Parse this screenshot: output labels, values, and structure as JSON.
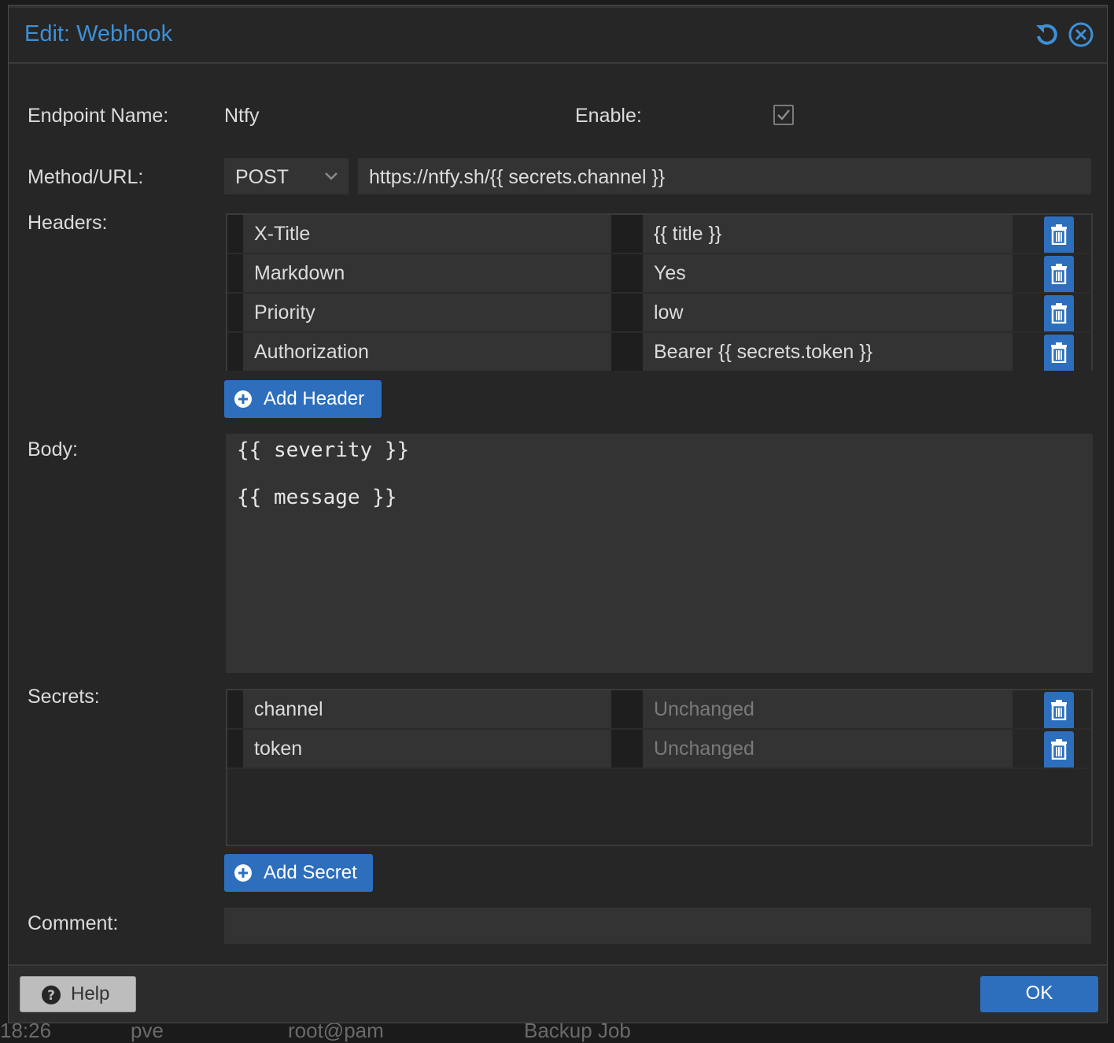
{
  "dialog": {
    "title": "Edit: Webhook",
    "reset_icon": "undo-icon",
    "close_icon": "close-circle-icon"
  },
  "form": {
    "endpoint_name_label": "Endpoint Name:",
    "endpoint_name_value": "Ntfy",
    "enable_label": "Enable:",
    "enable_checked": true,
    "method_url_label": "Method/URL:",
    "method_value": "POST",
    "url_value": "https://ntfy.sh/{{ secrets.channel }}",
    "headers_label": "Headers:",
    "headers": [
      {
        "key": "X-Title",
        "value": "{{ title }}"
      },
      {
        "key": "Markdown",
        "value": "Yes"
      },
      {
        "key": "Priority",
        "value": "low"
      },
      {
        "key": "Authorization",
        "value": "Bearer {{ secrets.token }}"
      }
    ],
    "add_header_label": "Add Header",
    "body_label": "Body:",
    "body_lines": [
      "{{ severity }}",
      "",
      "{{ message }}"
    ],
    "secrets_label": "Secrets:",
    "secrets": [
      {
        "key": "channel",
        "placeholder": "Unchanged"
      },
      {
        "key": "token",
        "placeholder": "Unchanged"
      }
    ],
    "add_secret_label": "Add Secret",
    "comment_label": "Comment:",
    "comment_value": ""
  },
  "footer": {
    "help_label": "Help",
    "ok_label": "OK"
  },
  "background": {
    "time": "18:26",
    "node": "pve",
    "user": "root@pam",
    "type": "Backup Job"
  },
  "colors": {
    "accent": "#2e6fbd",
    "title": "#3d8fd6",
    "dialog_bg": "#262626",
    "field_bg": "#333333"
  }
}
